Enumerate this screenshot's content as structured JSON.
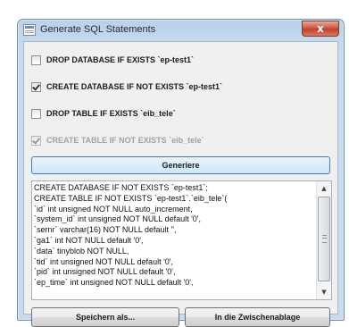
{
  "window": {
    "title": "Generate SQL Statements",
    "close_label": "x"
  },
  "icons": {
    "app": "sql-document-icon",
    "close": "close-icon"
  },
  "checkboxes": [
    {
      "label": "DROP DATABASE IF EXISTS `ep-test1`",
      "checked": false,
      "disabled": false
    },
    {
      "label": "CREATE DATABASE IF NOT EXISTS `ep-test1`",
      "checked": true,
      "disabled": false
    },
    {
      "label": "DROP TABLE IF EXISTS `eib_tele`",
      "checked": false,
      "disabled": false
    },
    {
      "label": "CREATE TABLE IF NOT EXISTS `eib_tele`",
      "checked": true,
      "disabled": true
    }
  ],
  "generate_button": "Generiere",
  "sql_text": [
    "CREATE DATABASE IF NOT EXISTS `ep-test1`;",
    "CREATE TABLE IF NOT EXISTS `ep-test1`.`eib_tele`(",
    "`id` int unsigned NOT NULL auto_increment,",
    "`system_id` int unsigned NOT NULL default '0',",
    "`sernr` varchar(16) NOT NULL default '',",
    "`ga1` int NOT NULL default '0',",
    "`data` tinyblob NOT NULL,",
    "`tid` int unsigned NOT NULL default '0',",
    "`pid` int unsigned NOT NULL default '0',",
    "`ep_time` int unsigned NOT NULL default '0',"
  ],
  "buttons": {
    "save": "Speichern als...",
    "clipboard": "In die Zwischenablage"
  }
}
